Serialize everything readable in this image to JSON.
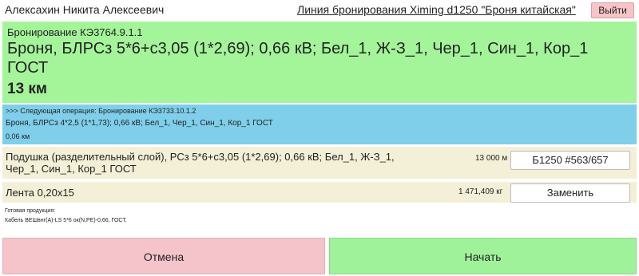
{
  "header": {
    "user_name": "Алексахин Никита Алексеевич",
    "line_title": "Линия бронирования Ximing d1250 \"Броня китайская\"",
    "exit_label": "Выйти"
  },
  "current_operation": {
    "code": "Бронирование КЭ3764.9.1.1",
    "description": "Броня, БЛРСз 5*6+с3,05 (1*2,69); 0,66 кВ; Бел_1, Ж-З_1, Чер_1, Син_1, Кор_1 ГОСТ",
    "length": "13 км",
    "color": "#a4f59a"
  },
  "next_operation": {
    "title": ">>> Следующая операция: Бронирование КЭ3733.10.1.2",
    "description": "Броня, БЛРСз 4*2,5 (1*1,73); 0,66 кВ; Бел_1, Чер_1, Син_1, Кор_1 ГОСТ",
    "length": "0,06 км",
    "color": "#7fcfea"
  },
  "materials": [
    {
      "name": "Подушка (разделительный слой), РСз 5*6+с3,05 (1*2,69); 0,66 кВ; Бел_1, Ж-З_1, Чер_1, Син_1, Кор_1 ГОСТ",
      "quantity": "13 000 м",
      "button_label": "Б1250 #563/657"
    },
    {
      "name": "Лента 0,20х15",
      "quantity": "1 471,409 кг",
      "button_label": "Заменить"
    }
  ],
  "products": {
    "label": "Готовая продукция:",
    "value": "Кабель ВЕШвнг(А)-LS 5*6 ок(N,PE)-0,66, ГОСТ,"
  },
  "actions": {
    "cancel_label": "Отмена",
    "start_label": "Начать"
  }
}
